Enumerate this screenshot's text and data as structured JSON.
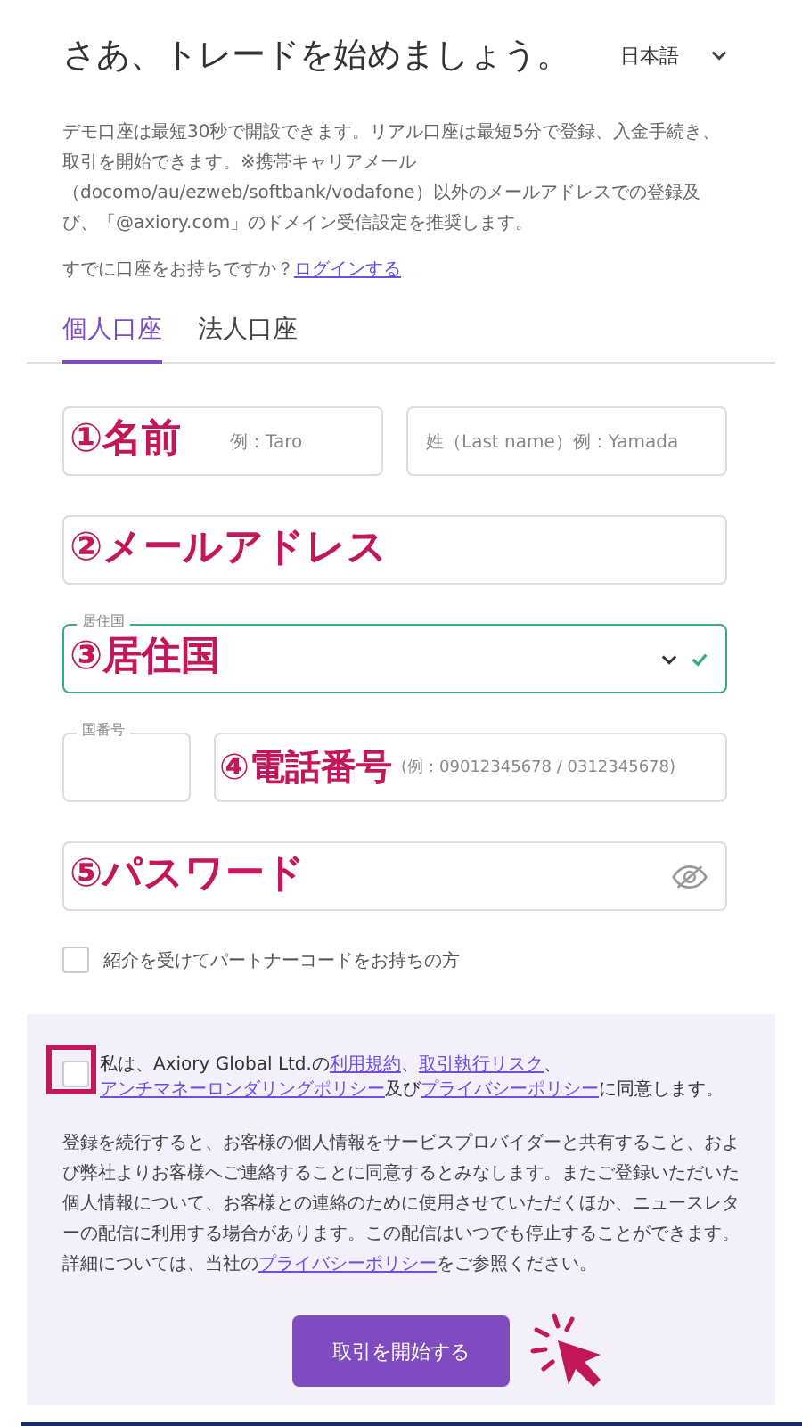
{
  "header": {
    "title": "さあ、トレードを始めましょう。",
    "language": "日本語"
  },
  "intro": "デモ口座は最短30秒で開設できます。リアル口座は最短5分で登録、入金手続き、取引を開始できます。※携帯キャリアメール（docomo/au/ezweb/softbank/vodafone）以外のメールアドレスでの登録及び、「@axiory.com」のドメイン受信設定を推奨します。",
  "login_prompt": {
    "text": "すでに口座をお持ちですか？",
    "link": "ログインする"
  },
  "tabs": [
    {
      "label": "個人口座",
      "selected": true
    },
    {
      "label": "法人口座",
      "selected": false
    }
  ],
  "form_rows": [
    {
      "annotation": "①名前",
      "fields": [
        {
          "kind": "text",
          "placeholder": "例：Taro"
        },
        {
          "kind": "text",
          "placeholder": "姓（Last name）例：Yamada"
        }
      ]
    },
    {
      "annotation": "②メールアドレス",
      "fields": [
        {
          "kind": "text"
        }
      ]
    },
    {
      "annotation": "③居住国",
      "fields": [
        {
          "kind": "select",
          "label": "居住国",
          "valid": true
        }
      ]
    },
    {
      "annotation": "④電話番号",
      "fields": [
        {
          "kind": "code",
          "label": "国番号"
        },
        {
          "kind": "text",
          "placeholder": "(例：09012345678 / 0312345678)"
        }
      ]
    },
    {
      "annotation": "⑤パスワード",
      "fields": [
        {
          "kind": "password"
        }
      ]
    }
  ],
  "referral": {
    "label": "紹介を受けてパートナーコードをお持ちの方",
    "checked": false
  },
  "terms": {
    "checked": false,
    "highlighted": true,
    "parts": [
      {
        "kind": "text",
        "text": "私は、Axiory Global Ltd.の"
      },
      {
        "kind": "link",
        "text": "利用規約"
      },
      {
        "kind": "text",
        "text": "、"
      },
      {
        "kind": "link",
        "text": "取引執行リスク"
      },
      {
        "kind": "text",
        "text": "、"
      },
      {
        "kind": "link",
        "text": "アンチマネーロンダリングポリシー"
      },
      {
        "kind": "text",
        "text": "及び"
      },
      {
        "kind": "link",
        "text": "プライバシーポリシー"
      },
      {
        "kind": "text",
        "text": "に同意します。"
      }
    ]
  },
  "notice": [
    {
      "kind": "text",
      "text": "登録を続行すると、お客様の個人情報をサービスプロバイダーと共有すること、および弊社よりお客様へご連絡することに同意するとみなします。またご登録いただいた個人情報について、お客様との連絡のために使用させていただくほか、ニュースレターの配信に利用する場合があります。この配信はいつでも停止することができます。詳細については、当社の"
    },
    {
      "kind": "link",
      "text": "プライバシーポリシー"
    },
    {
      "kind": "text",
      "text": "をご参照ください。"
    }
  ],
  "submit_button": "取引を開始する"
}
